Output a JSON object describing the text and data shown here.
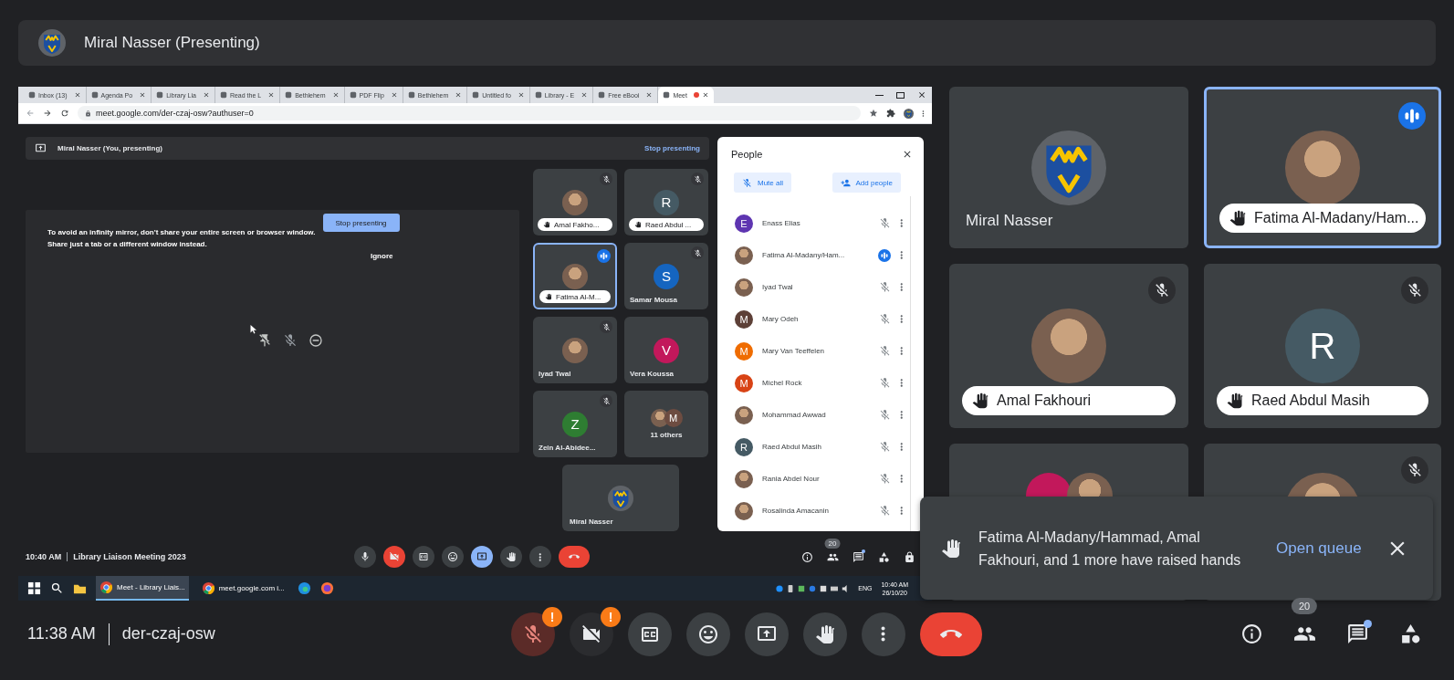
{
  "presenter_bar": {
    "title": "Miral Nasser (Presenting)"
  },
  "shared_screen": {
    "browser": {
      "tabs": [
        {
          "title": "Inbox (13)",
          "selected": false,
          "recording": false
        },
        {
          "title": "Agenda Po",
          "selected": false,
          "recording": false
        },
        {
          "title": "Library Lia",
          "selected": false,
          "recording": false
        },
        {
          "title": "Read the L",
          "selected": false,
          "recording": false
        },
        {
          "title": "Bethlehem",
          "selected": false,
          "recording": false
        },
        {
          "title": "PDF Flip",
          "selected": false,
          "recording": false
        },
        {
          "title": "Bethlehem",
          "selected": false,
          "recording": false
        },
        {
          "title": "Untitled fo",
          "selected": false,
          "recording": false
        },
        {
          "title": "Library - E",
          "selected": false,
          "recording": false
        },
        {
          "title": "Free eBooi",
          "selected": false,
          "recording": false
        },
        {
          "title": "Meet",
          "selected": true,
          "recording": true
        }
      ],
      "address": "meet.google.com/der-czaj-osw?authuser=0"
    },
    "meet": {
      "presenting_bar": {
        "title": "Miral Nasser (You, presenting)",
        "action": "Stop presenting"
      },
      "mirror_warning": {
        "lines": [
          "To avoid an infinity mirror, don't share your entire screen or browser window.",
          "Share just a tab or a different window instead."
        ],
        "button": "Stop presenting",
        "dismiss": "Ignore"
      },
      "tiles": [
        {
          "kind": "photo",
          "name": "Amal Fakho...",
          "hand_raised": true,
          "muted": true,
          "speaking": false,
          "selected": false
        },
        {
          "kind": "letter",
          "initial": "R",
          "color": "#455a64",
          "name": "Raed Abdul ...",
          "hand_raised": true,
          "muted": true,
          "speaking": false,
          "selected": false
        },
        {
          "kind": "photo",
          "name": "Fatima Al-M...",
          "hand_raised": true,
          "muted": false,
          "speaking": true,
          "selected": true
        },
        {
          "kind": "letter",
          "initial": "S",
          "color": "#1565c0",
          "name": "Samar Mousa",
          "hand_raised": false,
          "muted": true,
          "speaking": false,
          "selected": false
        },
        {
          "kind": "photo",
          "name": "Iyad Twal",
          "hand_raised": false,
          "muted": true,
          "speaking": false,
          "selected": false
        },
        {
          "kind": "letter",
          "initial": "V",
          "color": "#c2185b",
          "name": "Vera Koussa",
          "hand_raised": false,
          "muted": false,
          "speaking": false,
          "selected": false
        },
        {
          "kind": "letter",
          "initial": "Z",
          "color": "#2e7d32",
          "name": "Zein Al-Abidee...",
          "hand_raised": false,
          "muted": true,
          "speaking": false,
          "selected": false
        },
        {
          "kind": "group",
          "name": "11 others",
          "avatars": [
            {
              "kind": "photo"
            },
            {
              "kind": "letter",
              "initial": "M",
              "color": "#6d4c41"
            }
          ],
          "muted": false,
          "speaking": false,
          "selected": false
        },
        {
          "kind": "logo",
          "name": "Miral Nasser",
          "hand_raised": false,
          "muted": false,
          "speaking": false,
          "selected": false
        }
      ],
      "people": {
        "title": "People",
        "mute_all": "Mute all",
        "add_people": "Add people",
        "list": [
          {
            "kind": "letter",
            "initial": "E",
            "color": "#5e35b1",
            "name": "Enass Elias",
            "speaking": false
          },
          {
            "kind": "photo",
            "name": "Fatima Al-Madany/Ham...",
            "speaking": true
          },
          {
            "kind": "photo",
            "name": "Iyad Twal",
            "speaking": false
          },
          {
            "kind": "letter",
            "initial": "M",
            "color": "#5d4037",
            "name": "Mary Odeh",
            "speaking": false
          },
          {
            "kind": "letter",
            "initial": "M",
            "color": "#ef6c00",
            "name": "Mary Van Teeffelen",
            "speaking": false
          },
          {
            "kind": "letter",
            "initial": "M",
            "color": "#d84315",
            "name": "Michel Rock",
            "speaking": false
          },
          {
            "kind": "photo",
            "name": "Mohammad Awwad",
            "speaking": false
          },
          {
            "kind": "letter",
            "initial": "R",
            "color": "#455a64",
            "name": "Raed Abdul Masih",
            "speaking": false
          },
          {
            "kind": "photo",
            "name": "Rania Abdel Nour",
            "speaking": false
          },
          {
            "kind": "photo",
            "name": "Rosalinda Amacanin",
            "speaking": false
          }
        ]
      },
      "footer": {
        "time": "10:40 AM",
        "meeting": "Library Liaison Meeting 2023",
        "buttons": [
          {
            "kind": "mic",
            "on": true
          },
          {
            "kind": "camera",
            "on": false
          },
          {
            "kind": "captions",
            "on": false
          },
          {
            "kind": "emoji",
            "on": false
          },
          {
            "kind": "present",
            "on": true
          },
          {
            "kind": "hand",
            "on": false
          },
          {
            "kind": "more",
            "on": false
          },
          {
            "kind": "end"
          }
        ],
        "side": [
          {
            "kind": "info"
          },
          {
            "kind": "people",
            "badge": "20"
          },
          {
            "kind": "chat",
            "unread": true
          },
          {
            "kind": "activities"
          },
          {
            "kind": "lock"
          }
        ]
      }
    },
    "taskbar": {
      "apps": [
        {
          "kind": "start"
        },
        {
          "kind": "search"
        },
        {
          "kind": "folder"
        },
        {
          "kind": "chrome",
          "title": "Meet - Library Liais...",
          "selected": true
        },
        {
          "kind": "chrome",
          "title": "meet.google.com i...",
          "selected": false
        },
        {
          "kind": "edge"
        },
        {
          "kind": "firefox"
        }
      ],
      "language": "ENG",
      "time": "10:40 AM",
      "date": "26/10/20"
    }
  },
  "tiles": [
    {
      "kind": "logo",
      "name": "Miral Nasser",
      "hand_raised": false,
      "muted": false,
      "speaking": false,
      "selected": false
    },
    {
      "kind": "photo",
      "name": "Fatima Al-Madany/Ham...",
      "hand_raised": true,
      "muted": false,
      "speaking": true,
      "selected": true
    },
    {
      "kind": "photo",
      "name": "Amal Fakhouri",
      "hand_raised": true,
      "muted": true,
      "speaking": false,
      "selected": false
    },
    {
      "kind": "letter",
      "initial": "R",
      "color": "#455a64",
      "name": "Raed Abdul Masih",
      "hand_raised": true,
      "muted": true,
      "speaking": false,
      "selected": false
    },
    {
      "kind": "group",
      "avatars": [
        {
          "kind": "letter",
          "color": "#c2185b"
        },
        {
          "kind": "photo"
        }
      ],
      "muted": false,
      "speaking": false,
      "selected": false
    },
    {
      "kind": "photo",
      "muted": true,
      "speaking": false,
      "selected": false
    }
  ],
  "toast": {
    "message": "Fatima Al-Madany/Hammad, Amal Fakhouri, and 1 more have raised hands",
    "action": "Open queue"
  },
  "controls": {
    "time": "11:38 AM",
    "meeting_code": "der-czaj-osw",
    "buttons": [
      {
        "kind": "mic",
        "on": false,
        "blocked": true,
        "warning": "!"
      },
      {
        "kind": "camera",
        "on": false,
        "blocked": true,
        "warning": "!"
      },
      {
        "kind": "captions",
        "on": false
      },
      {
        "kind": "emoji",
        "on": false
      },
      {
        "kind": "present",
        "on": false
      },
      {
        "kind": "hand",
        "on": false
      },
      {
        "kind": "more",
        "on": false
      },
      {
        "kind": "end"
      }
    ],
    "side": [
      {
        "kind": "info"
      },
      {
        "kind": "people",
        "badge": "20"
      },
      {
        "kind": "chat",
        "unread": true
      },
      {
        "kind": "activities"
      }
    ]
  }
}
